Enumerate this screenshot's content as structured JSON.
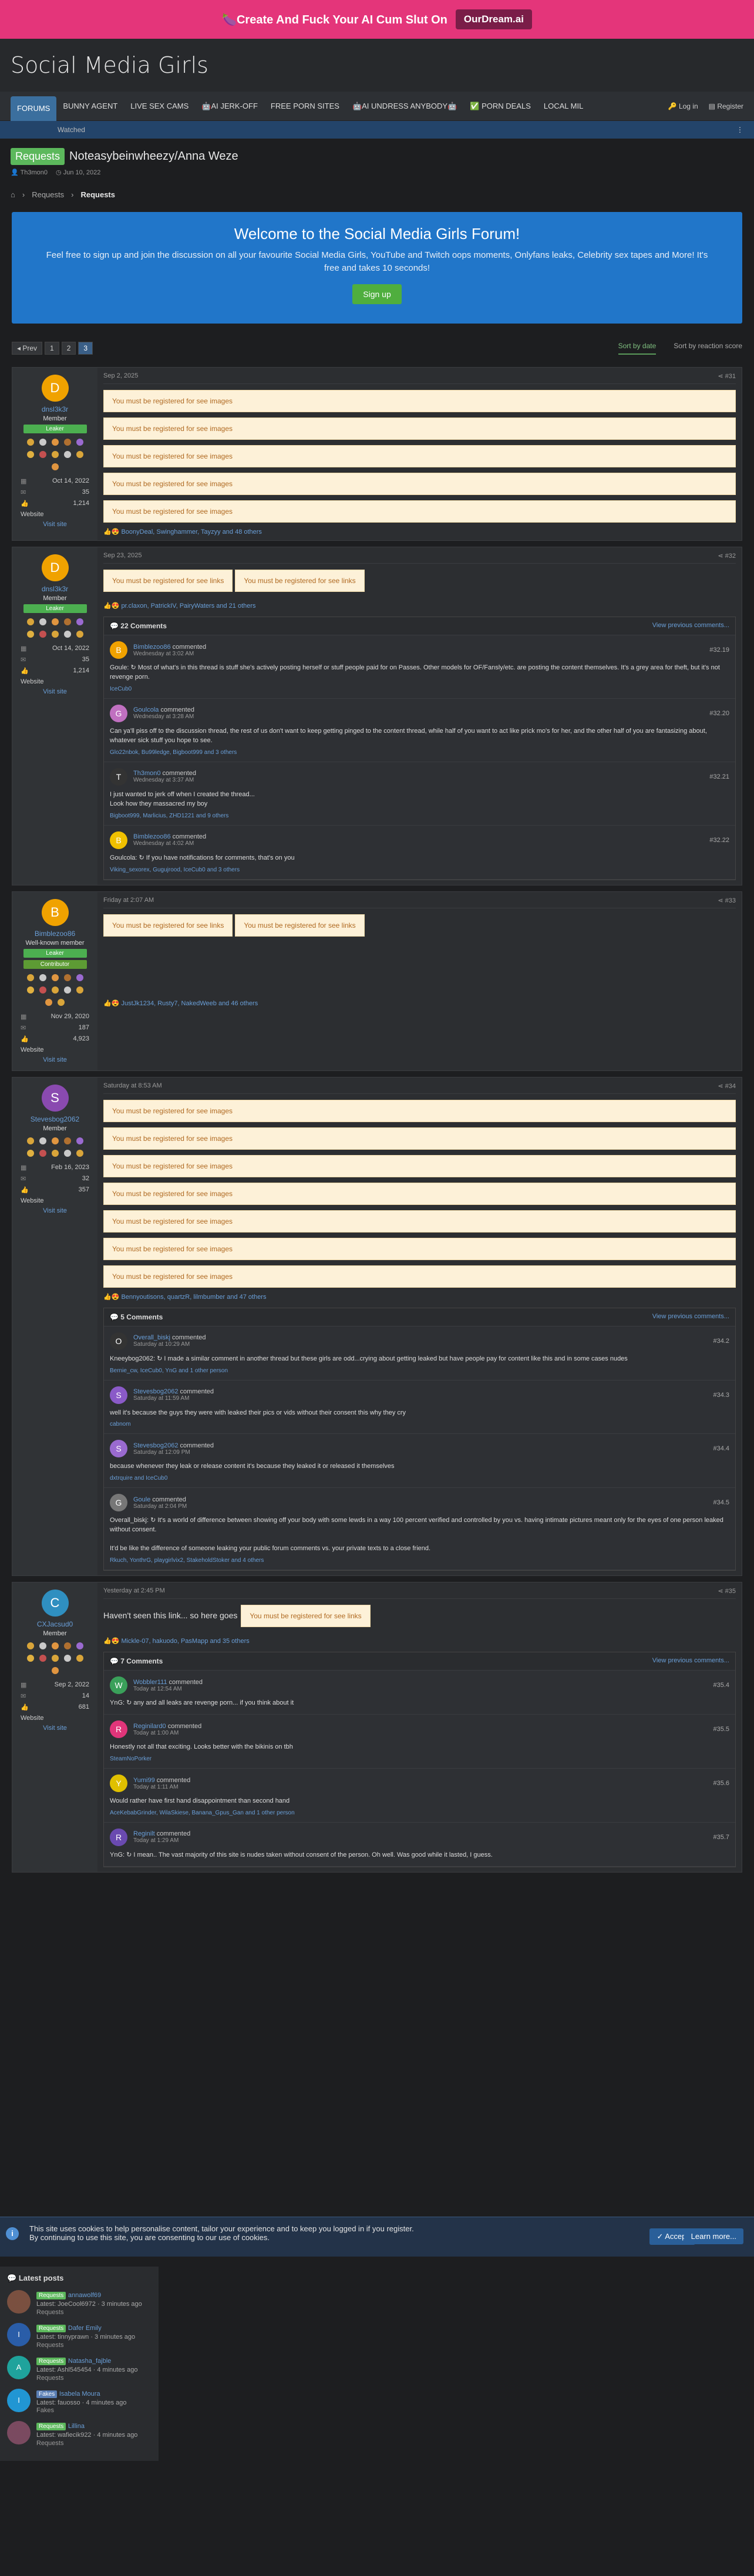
{
  "ad": {
    "text": "🍆Create And Fuck Your AI Cum Slut On",
    "button": "OurDream.ai"
  },
  "site": {
    "logo": "Social Media Girls"
  },
  "nav": {
    "items": [
      "FORUMS",
      "BUNNY AGENT",
      "LIVE SEX CAMS",
      "🤖AI JERK-OFF",
      "FREE PORN SITES",
      "🤖AI UNDRESS ANYBODY🤖",
      "✅ PORN DEALS",
      "LOCAL MIL"
    ],
    "login": "Log in",
    "register": "Register"
  },
  "subnav": {
    "watched": "Watched",
    "menu": "⋮"
  },
  "thread": {
    "prefix": "Requests",
    "title": "Noteasybeinwheezy/Anna Weze",
    "author": "Th3mon0",
    "date": "Jun 10, 2022"
  },
  "breadcrumb": {
    "home": "⌂",
    "b1": "Requests",
    "b2": "Requests"
  },
  "welcome": {
    "title": "Welcome to the Social Media Girls Forum!",
    "text": "Feel free to sign up and join the discussion on all your favourite Social Media Girls, YouTube and Twitch oops moments, Onlyfans leaks, Celebrity sex tapes and More! It's free and takes 10 seconds!",
    "signup": "Sign up"
  },
  "pager": {
    "prev": "◂ Prev",
    "pages": [
      "1",
      "2",
      "3"
    ],
    "sort_date": "Sort by date",
    "sort_score": "Sort by reaction score"
  },
  "reg_images": "You must be registered for see images",
  "reg_links": "You must be registered for see links",
  "posts": [
    {
      "date": "Sep 2, 2025",
      "num": "#31",
      "user": "dnsl3k3r",
      "title": "Member",
      "badge": "Leaker",
      "joined": "Oct 14, 2022",
      "msgs": "35",
      "score": "1,214",
      "website": "Website",
      "visit": "Visit site",
      "reactions": "BoonyDeal, Swinghammer, Tayzyy and 48 others"
    },
    {
      "date": "Sep 23, 2025",
      "num": "#32",
      "user": "dnsl3k3r",
      "title": "Member",
      "badge": "Leaker",
      "joined": "Oct 14, 2022",
      "msgs": "35",
      "score": "1,214",
      "website": "Website",
      "visit": "Visit site",
      "reactions": "pr.claxon, PatrickIV, PairyWaters and 21 others",
      "comments_title": "22 Comments",
      "prev_comments": "View previous comments...",
      "comments": [
        {
          "user": "Bimblezoo86",
          "action": "commented",
          "date": "Wednesday at 3:02 AM",
          "num": "#32.19",
          "text": "Goule: ↻ Most of what's in this thread is stuff she's actively posting herself or stuff people paid for on Passes. Other models for OF/Fansly/etc. are posting the content themselves. It's a grey area for theft, but it's not revenge porn.",
          "react": "IceCub0"
        },
        {
          "user": "Goulcola",
          "action": "commented",
          "date": "Wednesday at 3:28 AM",
          "num": "#32.20",
          "text": "Can ya'll piss off to the discussion thread, the rest of us don't want to keep getting pinged to the content thread, while half of you want to act like prick mo's for her, and the other half of you are fantasizing about, whatever sick stuff you hope to see.",
          "react": "Glo22nbok, Bu99ledge, Bigboot999 and 3 others"
        },
        {
          "user": "Th3mon0",
          "action": "commented",
          "date": "Wednesday at 3:37 AM",
          "num": "#32.21",
          "text": "I just wanted to jerk off when I created the thread...\nLook how they massacred my boy",
          "react": "Bigboot999, Marlicius, ZHD1221 and 9 others"
        },
        {
          "user": "Bimblezoo86",
          "action": "commented",
          "date": "Wednesday at 4:02 AM",
          "num": "#32.22",
          "text": "Goulcola: ↻ If you have notifications for comments, that's on you",
          "react": "Viking_sexorex, Gugujrood, IceCub0 and 3 others"
        }
      ]
    },
    {
      "date": "Friday at 2:07 AM",
      "num": "#33",
      "user": "Bimblezoo86",
      "title": "Well-known member",
      "badge": "Leaker",
      "badge2": "Contributor",
      "joined": "Nov 29, 2020",
      "msgs": "187",
      "score": "4,923",
      "website": "Website",
      "visit": "Visit site",
      "reactions": "JustJk1234, Rusty7, NakedWeeb and 46 others"
    },
    {
      "date": "Saturday at 8:53 AM",
      "num": "#34",
      "user": "Stevesbog2062",
      "title": "Member",
      "joined": "Feb 16, 2023",
      "msgs": "32",
      "score": "357",
      "website": "Website",
      "visit": "Visit site",
      "reactions": "Bennyoutisons, quartzR, lilmbumber and 47 others",
      "comments_title": "5 Comments",
      "prev_comments": "View previous comments...",
      "comments": [
        {
          "user": "Overall_biskj",
          "action": "commented",
          "date": "Saturday at 10:29 AM",
          "num": "#34.2",
          "text": "Kneeybog2062: ↻ I made a similar comment in another thread but these girls are odd...crying about getting leaked but have people pay for content like this and in some cases nudes",
          "react": "Bernie_cw, IceCub0, YnG and 1 other person"
        },
        {
          "user": "Stevesbog2062",
          "action": "commented",
          "date": "Saturday at 11:59 AM",
          "num": "#34.3",
          "text": "well it's because the guys they were with leaked their pics or vids without their consent this why they cry",
          "react": "cabnom"
        },
        {
          "user": "Stevesbog2062",
          "action": "commented",
          "date": "Saturday at 12:09 PM",
          "num": "#34.4",
          "text": "because whenever they leak or release content it's because they leaked it or released it themselves",
          "react": "dxtrquire and IceCub0"
        },
        {
          "user": "Goule",
          "action": "commented",
          "date": "Saturday at 2:04 PM",
          "num": "#34.5",
          "text": "Overall_biskj: ↻ It's a world of difference between showing off your body with some lewds in a way 100 percent verified and controlled by you vs. having intimate pictures meant only for the eyes of one person leaked without consent.\n\nIt'd be like the difference of someone leaking your public forum comments vs. your private texts to a close friend.",
          "react": "Rkuch, YonthrG, playgirlvix2, StakeholdStoker and 4 others"
        }
      ]
    },
    {
      "date": "Yesterday at 2:45 PM",
      "num": "#35",
      "user": "CXJacsud0",
      "title": "Member",
      "joined": "Sep 2, 2022",
      "msgs": "14",
      "score": "681",
      "website": "Website",
      "visit": "Visit site",
      "reactions": "Mickle-07, hakuodo, PasMapp and 35 others",
      "text": "Haven't seen this link... so here goes",
      "comments_title": "7 Comments",
      "prev_comments": "View previous comments...",
      "comments": [
        {
          "user": "Wobbler111",
          "action": "commented",
          "date": "Today at 12:54 AM",
          "num": "#35.4",
          "text": "YnG: ↻ any and all leaks are revenge porn... if you think about it",
          "react": ""
        },
        {
          "user": "Reginilard0",
          "action": "commented",
          "date": "Today at 1:00 AM",
          "num": "#35.5",
          "text": "Honestly not all that exciting. Looks better with the bikinis on tbh",
          "react": "SteamNoPorker"
        },
        {
          "user": "Yumi99",
          "action": "commented",
          "date": "Today at 1:11 AM",
          "num": "#35.6",
          "text": "Would rather have first hand disappointment than second hand",
          "react": "AceKebabGrinder, WilaSkiese, Banana_Gpus_Gan and 1 other person"
        },
        {
          "user": "Reginilt",
          "action": "commented",
          "date": "Today at 1:29 AM",
          "num": "#35.7",
          "text": "YnG: ↻ I mean.. The vast majority of this site is nudes taken without consent of the person. Oh well. Was good while it lasted, I guess.",
          "react": ""
        }
      ]
    }
  ],
  "cookie": {
    "line1": "This site uses cookies to help personalise content, tailor your experience and to keep you logged in if you register.",
    "line2": "By continuing to use this site, you are consenting to our use of cookies.",
    "accept": "✓ Accept",
    "learn": "Learn more..."
  },
  "latest": {
    "title": "Latest posts",
    "items": [
      {
        "tag": "Requests",
        "title": "annawolf69",
        "meta": "Latest: JoeCool6972 · 3 minutes ago",
        "forum": "Requests",
        "letter": "",
        "color": "#7a5040"
      },
      {
        "tag": "Requests",
        "title": "Dafer Emily",
        "meta": "Latest: tinnyprawn · 3 minutes ago",
        "forum": "Requests",
        "letter": "I",
        "color": "#2a5da8"
      },
      {
        "tag": "Requests",
        "title": "Natasha_fajble",
        "meta": "Latest: Ashl545454 · 4 minutes ago",
        "forum": "Requests",
        "letter": "A",
        "color": "#1fa39c"
      },
      {
        "tag": "Fakes",
        "title": "Isabela Moura",
        "meta": "Latest: fauosso · 4 minutes ago",
        "forum": "Fakes",
        "letter": "I",
        "color": "#2196d3"
      },
      {
        "tag": "Requests",
        "title": "Lillina",
        "meta": "Latest: wafiecik922 · 4 minutes ago",
        "forum": "Requests",
        "letter": "",
        "color": "#7a4a60"
      }
    ]
  }
}
